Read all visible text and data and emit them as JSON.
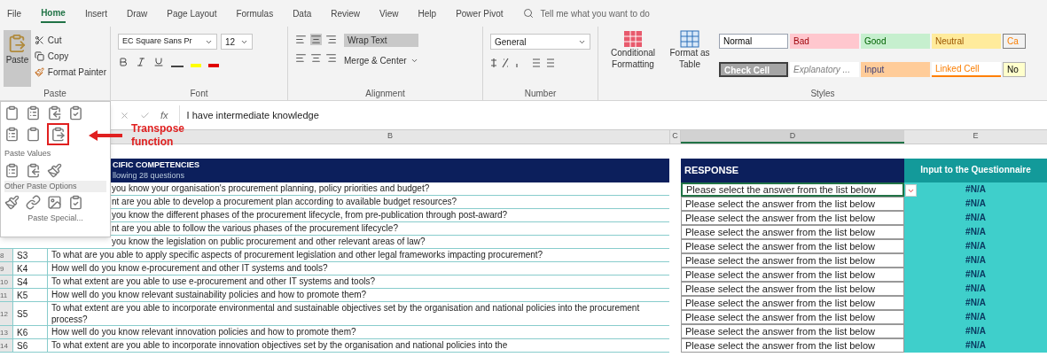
{
  "menu_tabs": [
    {
      "label": "File",
      "selected": false
    },
    {
      "label": "Home",
      "selected": true
    },
    {
      "label": "Insert",
      "selected": false
    },
    {
      "label": "Draw",
      "selected": false
    },
    {
      "label": "Page Layout",
      "selected": false
    },
    {
      "label": "Formulas",
      "selected": false
    },
    {
      "label": "Data",
      "selected": false
    },
    {
      "label": "Review",
      "selected": false
    },
    {
      "label": "View",
      "selected": false
    },
    {
      "label": "Help",
      "selected": false
    },
    {
      "label": "Power Pivot",
      "selected": false
    }
  ],
  "search": {
    "placeholder": "Tell me what you want to do"
  },
  "ribbon": {
    "clipboard": {
      "paste": "Paste",
      "cut": "Cut",
      "copy": "Copy",
      "format_painter": "Format Painter",
      "label": "Paste"
    },
    "font": {
      "name": "EC Square Sans Pr",
      "size": "12",
      "label": "Font"
    },
    "alignment": {
      "wrap_text": "Wrap Text",
      "merge": "Merge & Center",
      "label": "Alignment"
    },
    "number": {
      "format": "General",
      "label": "Number"
    },
    "styles": {
      "conditional": "Conditional Formatting",
      "format_table": "Format as Table",
      "label": "Styles",
      "cells": [
        {
          "label": "Normal",
          "kind": "normal"
        },
        {
          "label": "Bad",
          "kind": "bad"
        },
        {
          "label": "Good",
          "kind": "good"
        },
        {
          "label": "Neutral",
          "kind": "neutral"
        },
        {
          "label": "Ca",
          "kind": "calculation"
        },
        {
          "label": "Check Cell",
          "kind": "check"
        },
        {
          "label": "Explanatory ...",
          "kind": "explanatory"
        },
        {
          "label": "Input",
          "kind": "input"
        },
        {
          "label": "Linked Cell",
          "kind": "linked"
        },
        {
          "label": "No",
          "kind": "note"
        }
      ]
    }
  },
  "formula_bar": {
    "function_label": "fx",
    "value": "I have intermediate knowledge"
  },
  "column_headers": {
    "question": "B",
    "gap": "C",
    "response": "D",
    "input": "E"
  },
  "paste_menu": {
    "values_heading": "Paste Values",
    "other_heading": "Other Paste Options",
    "special": "Paste Special..."
  },
  "annotation": {
    "text": "Transpose function"
  },
  "table": {
    "title": "CIFIC COMPETENCIES",
    "subtitle": "llowing 28 questions",
    "rows": [
      {
        "question": "you know your organisation's procurement planning, policy priorities and budget?"
      },
      {
        "question": "nt are you able to develop a procurement plan according to available budget resources?"
      },
      {
        "question": "you know the different phases of the procurement lifecycle, from pre-publication through post-award?"
      },
      {
        "question": "nt are you able to follow the various phases of the procurement lifecycle?"
      },
      {
        "question": "you know the legislation on public procurement and other relevant areas of law?"
      },
      {
        "row": "8",
        "id": "S3",
        "question": "To what are you able to apply specific aspects of procurement legislation and other legal frameworks impacting procurement?"
      },
      {
        "row": "9",
        "id": "K4",
        "question": "How well do you know e-procurement and other IT systems and tools?"
      },
      {
        "row": "10",
        "id": "S4",
        "question": "To what extent are you able to use e-procurement and other IT systems and tools?"
      },
      {
        "row": "11",
        "id": "K5",
        "question": "How well do you know relevant sustainability policies and how to promote them?"
      },
      {
        "row": "12",
        "id": "S5",
        "question": "To what extent are you able to incorporate environmental and sustainable objectives set by the organisation and national policies into the procurement process?"
      },
      {
        "row": "13",
        "id": "K6",
        "question": "How well do you know relevant innovation policies and how to promote them?"
      },
      {
        "row": "14",
        "id": "S6",
        "question": "To what extent are you able to incorporate innovation objectives set by the organisation and national policies into the"
      }
    ]
  },
  "response": {
    "header": "RESPONSE",
    "rows": [
      {
        "value": "Please select the answer from the list below",
        "selected": true
      },
      {
        "value": "Please select the answer from the list below",
        "selected": false
      },
      {
        "value": "Please select the answer from the list below",
        "selected": false
      },
      {
        "value": "Please select the answer from the list below",
        "selected": false
      },
      {
        "value": "Please select the answer from the list below",
        "selected": false
      },
      {
        "value": "Please select the answer from the list below",
        "selected": false
      },
      {
        "value": "Please select the answer from the list below",
        "selected": false
      },
      {
        "value": "Please select the answer from the list below",
        "selected": false
      },
      {
        "value": "Please select the answer from the list below",
        "selected": false
      },
      {
        "value": "Please select the answer from the list below",
        "selected": false
      },
      {
        "value": "Please select the answer from the list below",
        "selected": false
      },
      {
        "value": "Please select the answer from the list below",
        "selected": false
      }
    ]
  },
  "input": {
    "header": "Input to the Questionnaire",
    "values": [
      "#N/A",
      "#N/A",
      "#N/A",
      "#N/A",
      "#N/A",
      "#N/A",
      "#N/A",
      "#N/A",
      "#N/A",
      "#N/A",
      "#N/A",
      "#N/A"
    ]
  }
}
